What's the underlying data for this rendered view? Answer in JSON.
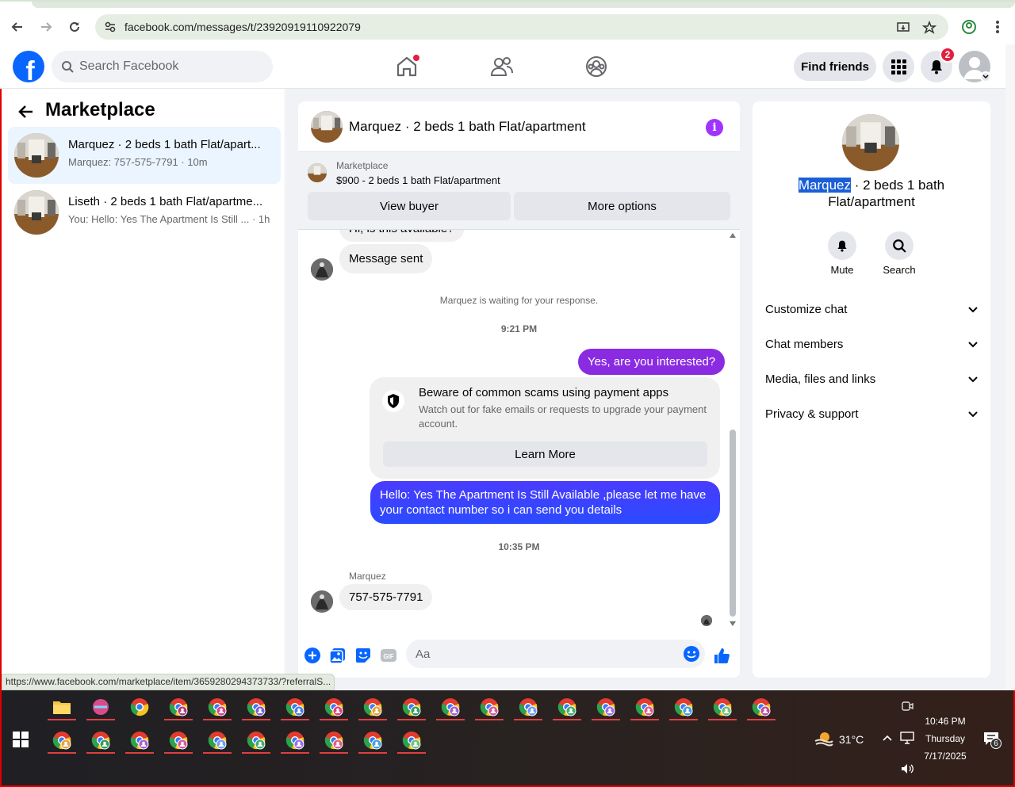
{
  "browser": {
    "url": "facebook.com/messages/t/23920919110922079",
    "status_url": "https://www.facebook.com/marketplace/item/3659280294373733/?referralS..."
  },
  "header": {
    "search_placeholder": "Search Facebook",
    "find_friends": "Find friends",
    "notification_count": "2"
  },
  "left": {
    "title": "Marketplace",
    "conversations": [
      {
        "name": "Marquez · 2 beds 1 bath Flat/apart...",
        "subtitle": "Marquez: 757-575-7791 · 10m",
        "active": true
      },
      {
        "name": "Liseth · 2 beds 1 bath Flat/apartme...",
        "subtitle": "You: Hello: Yes The Apartment Is Still ...  · 1h",
        "active": false
      }
    ]
  },
  "chat": {
    "title": "Marquez · 2 beds 1 bath Flat/apartment",
    "listing_label": "Marketplace",
    "listing_price": "$900 - 2 beds 1 bath Flat/apartment",
    "view_buyer": "View buyer",
    "more_options": "More options",
    "partial_message": "Hi, is this available?",
    "message_sent": "Message sent",
    "waiting_text": "Marquez is waiting for your response.",
    "time1": "9:21 PM",
    "out_msg1": "Yes, are you interested?",
    "warning_title": "Beware of common scams using payment apps",
    "warning_body": "Watch out for fake emails or requests to upgrade your payment account.",
    "learn_more": "Learn More",
    "out_msg2": "Hello: Yes The Apartment Is Still Available ,please let me have your contact number so i can send you details",
    "time2": "10:35 PM",
    "sender_name": "Marquez",
    "in_msg": "757-575-7791",
    "composer_placeholder": "Aa"
  },
  "right": {
    "title_highlight": "Marquez",
    "title_rest": " · 2 beds 1 bath Flat/apartment",
    "mute": "Mute",
    "search": "Search",
    "rows": [
      "Customize chat",
      "Chat members",
      "Media, files and links",
      "Privacy & support"
    ]
  },
  "taskbar": {
    "temperature": "31°C",
    "time": "10:46 PM",
    "day": "Thursday",
    "date": "7/17/2025",
    "notif_count": "6"
  },
  "colors": {
    "fb_blue": "#0866ff",
    "messenger_purple": "#a033ff",
    "bubble_gradient_top": "#8a2be2",
    "bubble_gradient_bottom": "#2b4bff"
  }
}
